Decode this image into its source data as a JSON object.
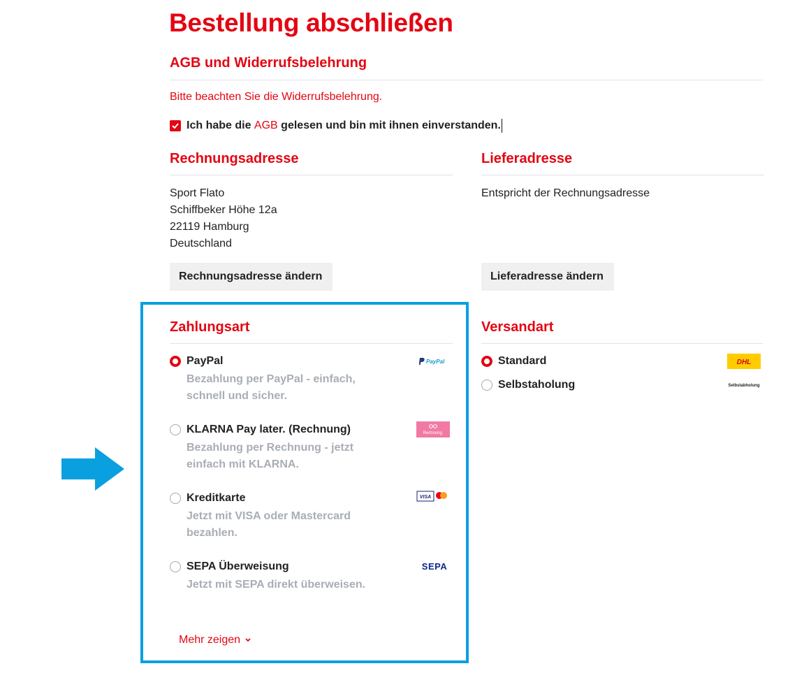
{
  "page": {
    "title": "Bestellung abschließen"
  },
  "agb": {
    "heading": "AGB und Widerrufsbelehrung",
    "note": "Bitte beachten Sie die Widerrufsbelehrung.",
    "checkbox_checked": true,
    "consent_before": "Ich habe die",
    "consent_link": "AGB",
    "consent_after": "gelesen und bin mit ihnen einverstanden."
  },
  "billing": {
    "heading": "Rechnungsadresse",
    "lines": [
      "Sport Flato",
      "Schiffbeker Höhe 12a",
      "22119 Hamburg",
      "Deutschland"
    ],
    "change_label": "Rechnungsadresse ändern"
  },
  "shipping": {
    "heading": "Lieferadresse",
    "text": "Entspricht der Rechnungsadresse",
    "change_label": "Lieferadresse ändern"
  },
  "payment": {
    "heading": "Zahlungsart",
    "options": [
      {
        "name": "PayPal",
        "description": "Bezahlung per PayPal - einfach, schnell und sicher.",
        "selected": true,
        "logo_icon": "paypal-logo-icon",
        "logo_text": "PayPal"
      },
      {
        "name": "KLARNA Pay later. (Rechnung)",
        "description": "Bezahlung per Rechnung - jetzt einfach mit KLARNA.",
        "selected": false,
        "logo_icon": "klarna-logo-icon",
        "logo_text": "Rechnung."
      },
      {
        "name": "Kreditkarte",
        "description": "Jetzt mit VISA oder Mastercard bezahlen.",
        "selected": false,
        "logo_icon": "visa-mastercard-logo-icon",
        "logo_text": "VISA"
      },
      {
        "name": "SEPA Überweisung",
        "description": "Jetzt mit SEPA direkt überweisen.",
        "selected": false,
        "logo_icon": "sepa-logo-icon",
        "logo_text": "SEPA"
      }
    ],
    "more_label": "Mehr zeigen"
  },
  "shipping_method": {
    "heading": "Versandart",
    "options": [
      {
        "name": "Standard",
        "selected": true,
        "logo_icon": "dhl-logo-icon",
        "logo_text": "DHL"
      },
      {
        "name": "Selbstaholung",
        "selected": false,
        "logo_icon": "selbstabholung-logo-icon",
        "logo_text": "Selbstabholung"
      }
    ]
  },
  "colors": {
    "accent": "#e30613",
    "highlight": "#0aa0e0",
    "muted_text": "#a9aeb5",
    "button_bg": "#f0f0f0"
  }
}
